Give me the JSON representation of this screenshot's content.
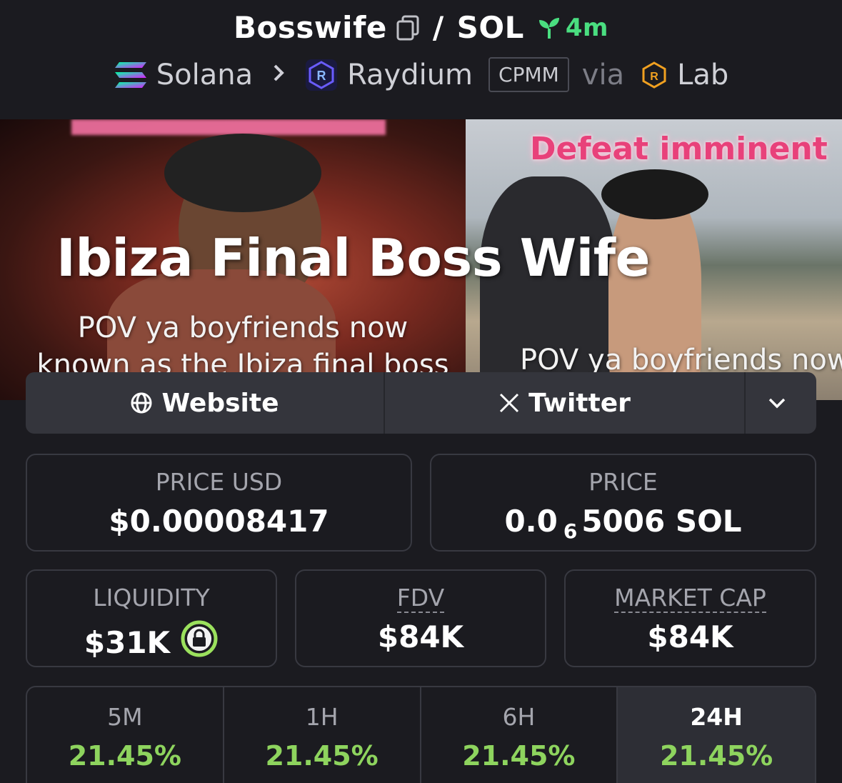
{
  "header": {
    "token_name": "Bosswife",
    "separator": "/",
    "quote": "SOL",
    "age": "4m",
    "chain": "Solana",
    "dex": "Raydium",
    "pool_type": "CPMM",
    "via": "via",
    "launchpad": "Lab"
  },
  "banner": {
    "title": "Ibiza Final Boss Wife",
    "overlay_top_right": "Defeat imminent",
    "caption_left_line1": "POV ya boyfriends now",
    "caption_left_line2": "known as the Ibiza final boss",
    "caption_right": "POV ya boyfriends now"
  },
  "links": {
    "website": "Website",
    "twitter": "Twitter"
  },
  "stats": {
    "price_usd_label": "PRICE USD",
    "price_usd": "$0.00008417",
    "price_label": "PRICE",
    "price_prefix": "0.0",
    "price_zeros": "6",
    "price_suffix": "5006 SOL",
    "liquidity_label": "LIQUIDITY",
    "liquidity": "$31K",
    "fdv_label": "FDV",
    "fdv": "$84K",
    "mcap_label": "MARKET CAP",
    "mcap": "$84K"
  },
  "changes": [
    {
      "period": "5M",
      "value": "21.45%"
    },
    {
      "period": "1H",
      "value": "21.45%"
    },
    {
      "period": "6H",
      "value": "21.45%"
    },
    {
      "period": "24H",
      "value": "21.45%"
    }
  ],
  "colors": {
    "background": "#1b1b20",
    "positive": "#8ed45e",
    "age_green": "#4ade80",
    "lock_green": "#9be15d"
  }
}
